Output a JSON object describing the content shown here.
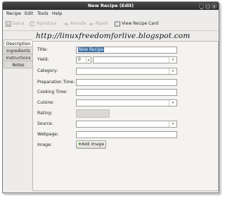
{
  "window": {
    "title": "New Recipe (Edit)"
  },
  "menu": [
    "Recipe",
    "Edit",
    "Tools",
    "Help"
  ],
  "toolbar": {
    "save": "Salva",
    "revert": "Ripristina",
    "undo": "Annulla",
    "redo": "Ripeti",
    "view_card": "View Recipe Card"
  },
  "watermark": "http://linuxfreedomforlive.blogspot.com",
  "tabs": [
    "Description",
    "Ingredients",
    "Instructions",
    "Notes"
  ],
  "form": {
    "title_label": "Title:",
    "title_value": "New Recipe",
    "yield_label": "Yield:",
    "yield_value": "0",
    "category_label": "Category:",
    "prep_label": "Preparation Time:",
    "cook_label": "Cooking Time:",
    "cuisine_label": "Cuisine:",
    "rating_label": "Rating:",
    "source_label": "Source:",
    "webpage_label": "Webpage:",
    "image_label": "Image:",
    "add_image": "Add Image"
  },
  "colors": {
    "accent": "#3b6ea5",
    "window_bg": "#edeceb"
  }
}
